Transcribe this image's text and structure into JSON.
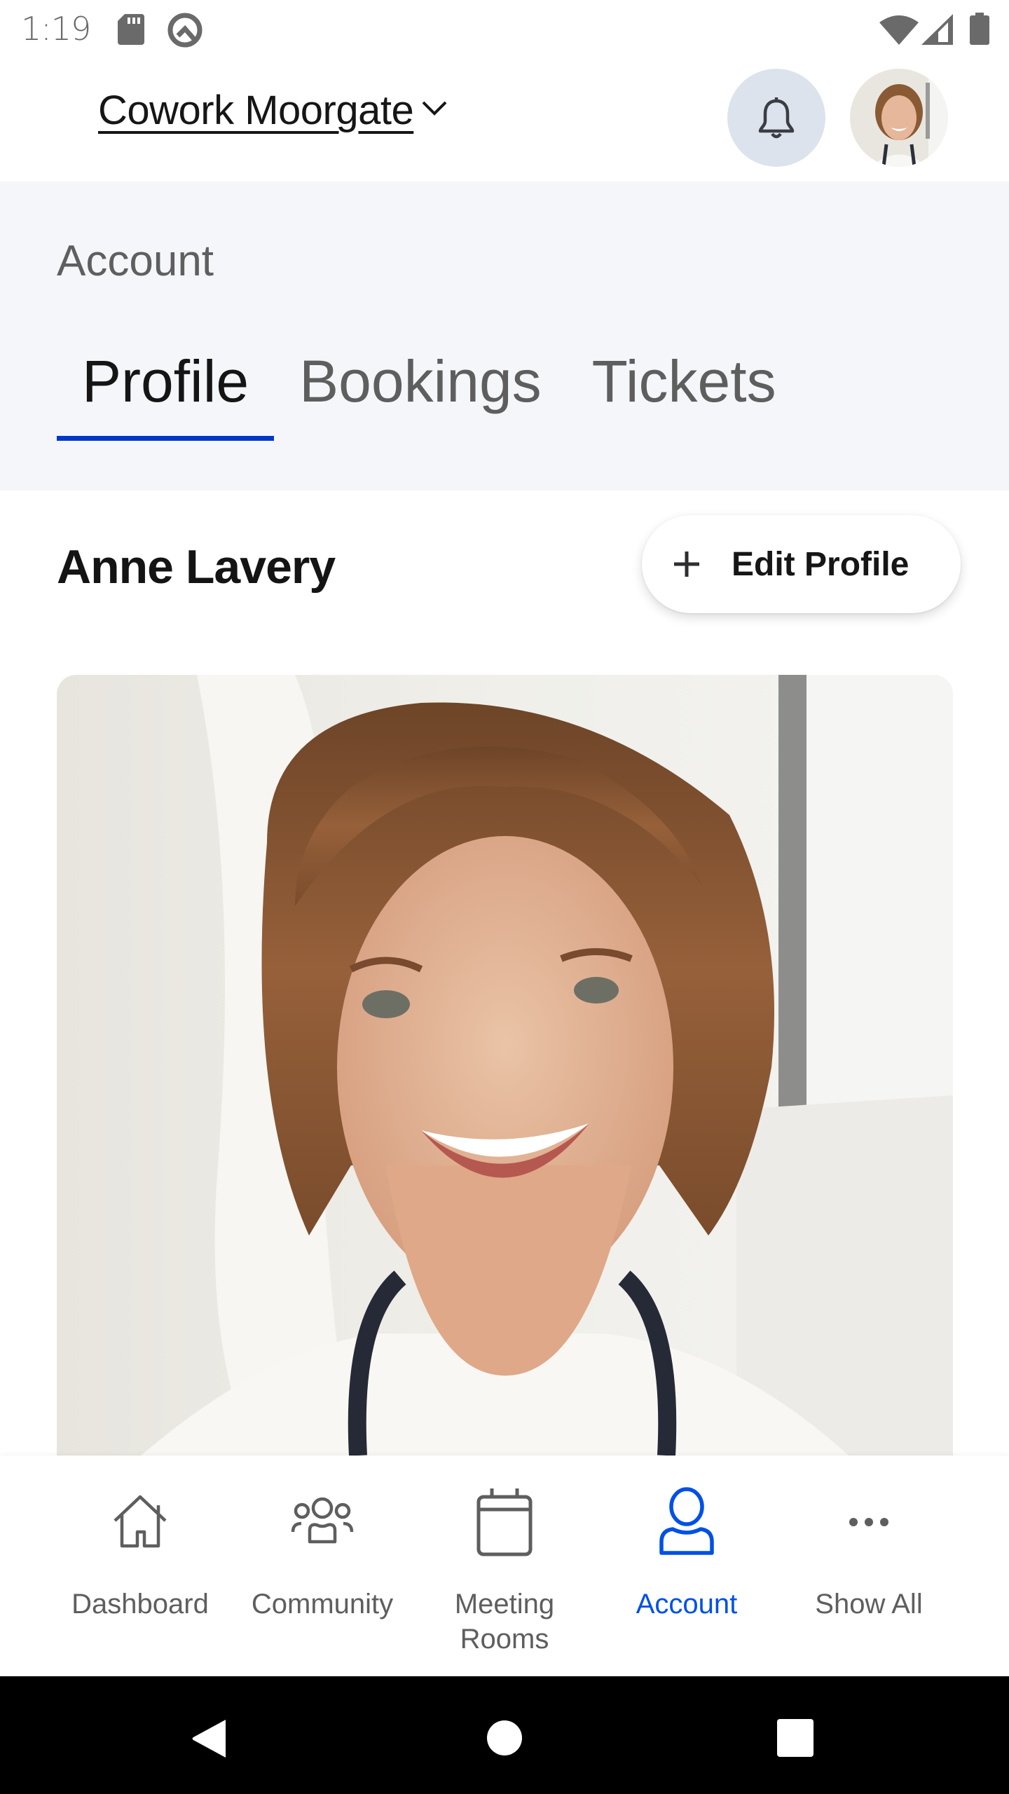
{
  "status_bar": {
    "time": "1:19",
    "icons": [
      "sd-card-icon",
      "q-icon",
      "wifi-icon",
      "signal-icon",
      "battery-icon"
    ]
  },
  "header": {
    "location": "Cowork Moorgate",
    "location_dropdown_icon": "chevron-down-icon",
    "notification_icon": "bell-icon",
    "avatar_alt": "Anne Lavery"
  },
  "account": {
    "section_label": "Account",
    "tabs": [
      {
        "label": "Profile",
        "active": true
      },
      {
        "label": "Bookings",
        "active": false
      },
      {
        "label": "Tickets",
        "active": false
      }
    ]
  },
  "profile": {
    "name": "Anne Lavery",
    "edit_button_label": "Edit Profile",
    "edit_button_icon": "plus-icon"
  },
  "bottom_nav": {
    "items": [
      {
        "label": "Dashboard",
        "icon": "home-icon",
        "active": false
      },
      {
        "label": "Community",
        "icon": "people-icon",
        "active": false
      },
      {
        "label": "Meeting Rooms",
        "icon": "calendar-icon",
        "active": false
      },
      {
        "label": "Account",
        "icon": "user-icon",
        "active": true
      },
      {
        "label": "Show All",
        "icon": "more-icon",
        "active": false
      }
    ]
  },
  "colors": {
    "accent": "#0037c9",
    "nav_active": "#0050e6",
    "section_bg": "#f4f6f9",
    "bell_bg": "#dde3ed",
    "icon_gray": "#5e5e5e"
  }
}
